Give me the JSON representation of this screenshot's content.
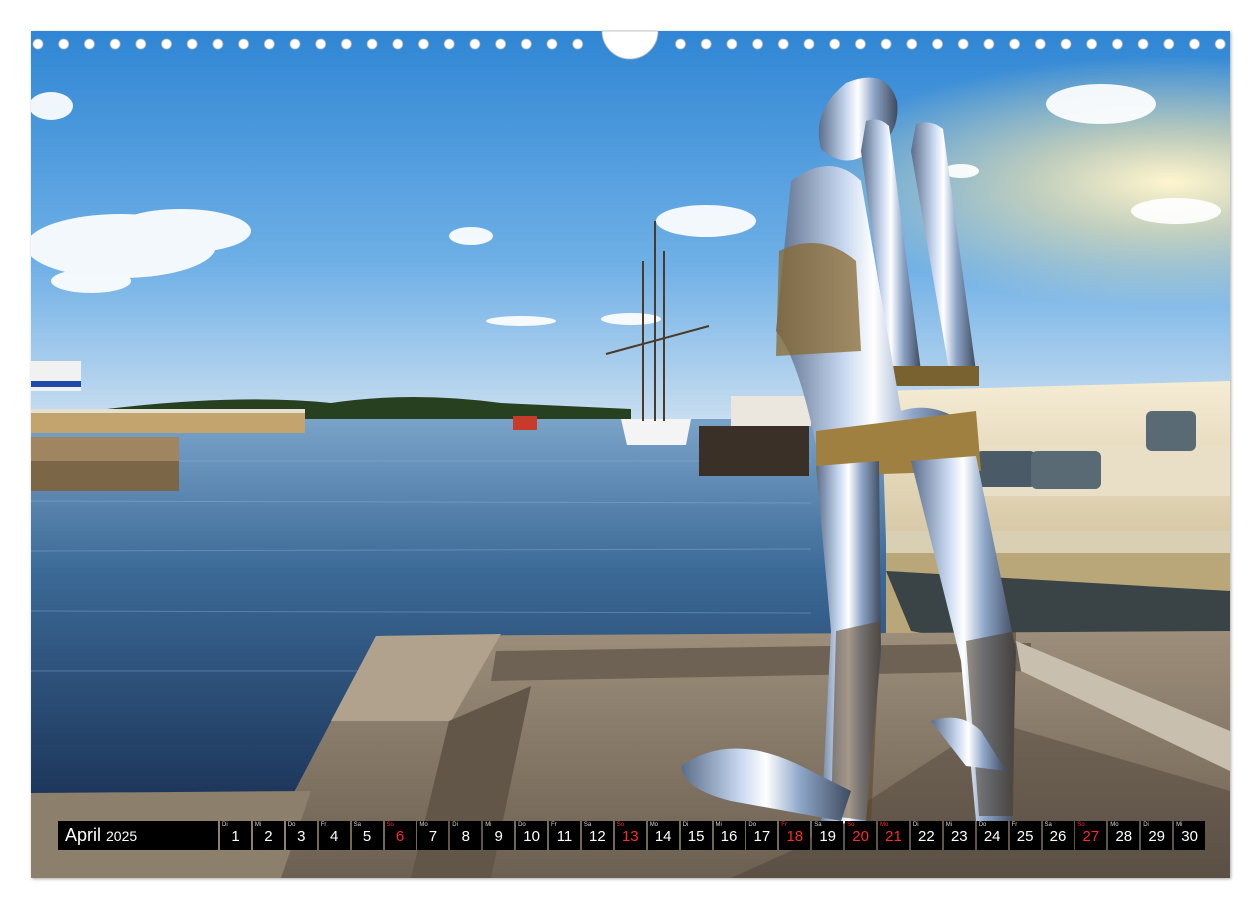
{
  "calendar": {
    "month": "April",
    "year": "2025",
    "sunday_color": "#ff2a2a",
    "days": [
      {
        "wd": "Di",
        "d": "1"
      },
      {
        "wd": "Mi",
        "d": "2"
      },
      {
        "wd": "Do",
        "d": "3"
      },
      {
        "wd": "Fr",
        "d": "4"
      },
      {
        "wd": "Sa",
        "d": "5"
      },
      {
        "wd": "So",
        "d": "6",
        "sun": true
      },
      {
        "wd": "Mo",
        "d": "7"
      },
      {
        "wd": "Di",
        "d": "8"
      },
      {
        "wd": "Mi",
        "d": "9"
      },
      {
        "wd": "Do",
        "d": "10"
      },
      {
        "wd": "Fr",
        "d": "11"
      },
      {
        "wd": "Sa",
        "d": "12"
      },
      {
        "wd": "So",
        "d": "13",
        "sun": true
      },
      {
        "wd": "Mo",
        "d": "14"
      },
      {
        "wd": "Di",
        "d": "15"
      },
      {
        "wd": "Mi",
        "d": "16"
      },
      {
        "wd": "Do",
        "d": "17"
      },
      {
        "wd": "Fr",
        "d": "18",
        "sun": true
      },
      {
        "wd": "Sa",
        "d": "19"
      },
      {
        "wd": "So",
        "d": "20",
        "sun": true
      },
      {
        "wd": "Mo",
        "d": "21",
        "sun": true
      },
      {
        "wd": "Di",
        "d": "22"
      },
      {
        "wd": "Mi",
        "d": "23"
      },
      {
        "wd": "Do",
        "d": "24"
      },
      {
        "wd": "Fr",
        "d": "25"
      },
      {
        "wd": "Sa",
        "d": "26"
      },
      {
        "wd": "So",
        "d": "27",
        "sun": true
      },
      {
        "wd": "Mo",
        "d": "28"
      },
      {
        "wd": "Di",
        "d": "29"
      },
      {
        "wd": "Mi",
        "d": "30"
      }
    ]
  },
  "photo": {
    "subject": "chrome-statue-on-harbour-pier",
    "sky_color": "#3f8fd6",
    "water_color": "#1f3a66",
    "pier_color": "#8a7d6c"
  }
}
